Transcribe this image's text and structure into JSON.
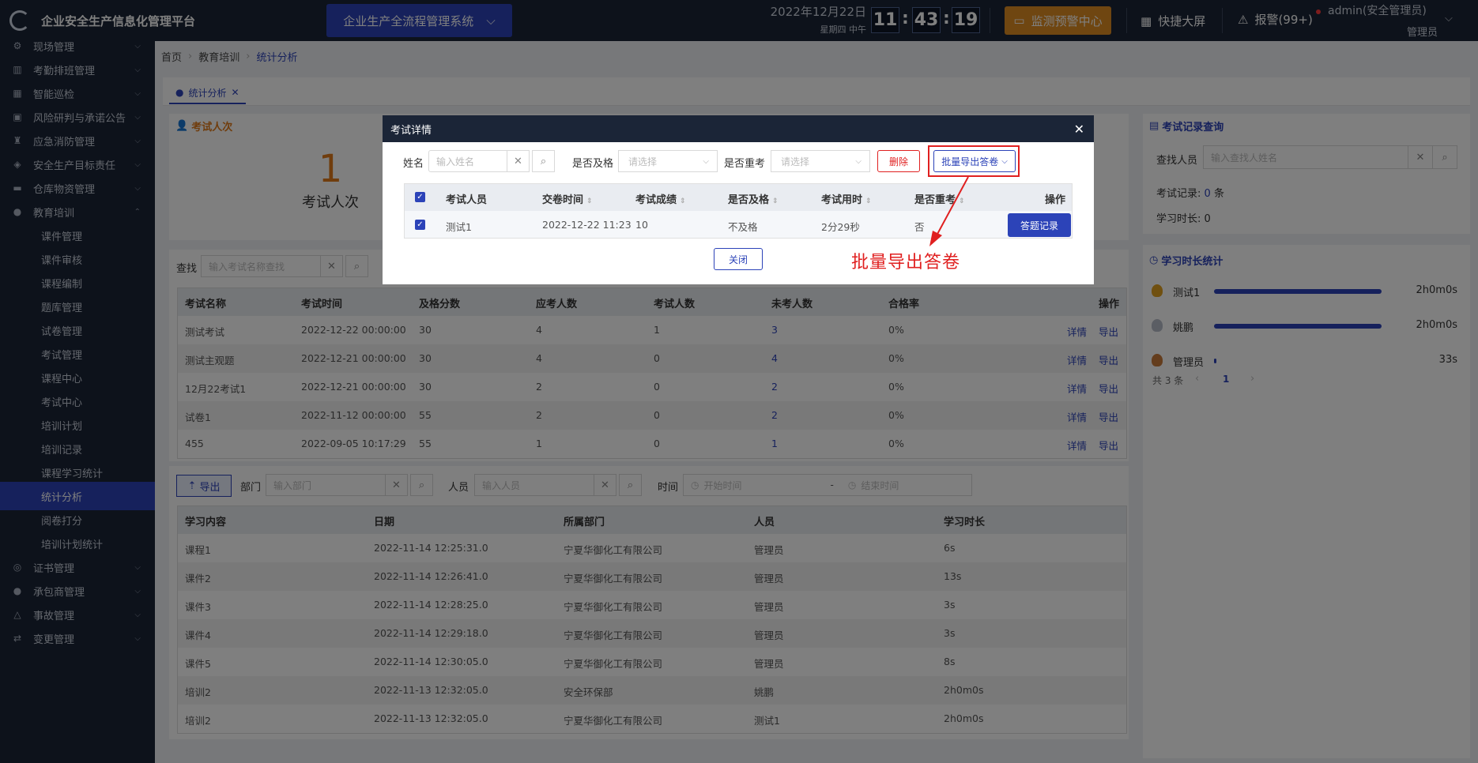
{
  "header": {
    "app_title": "企业安全生产信息化管理平台",
    "system_button": "企业生产全流程管理系统",
    "date": "2022年12月22日",
    "weekday": "星期四  中午",
    "time_h": "11",
    "time_m": "43",
    "time_s": "19",
    "monitor_button": "监测预警中心",
    "big_screen": "快捷大屏",
    "alarm": "报警(99+)",
    "user_name": "admin(安全管理员)",
    "user_role": "管理员"
  },
  "sidebar": {
    "items": [
      {
        "label": "现场管理",
        "icon": "gear-icon"
      },
      {
        "label": "考勤排班管理",
        "icon": "bar-chart-icon"
      },
      {
        "label": "智能巡检",
        "icon": "grid-icon"
      },
      {
        "label": "风险研判与承诺公告",
        "icon": "briefcase-icon"
      },
      {
        "label": "应急消防管理",
        "icon": "fire-extinguisher-icon"
      },
      {
        "label": "安全生产目标责任",
        "icon": "target-icon"
      },
      {
        "label": "仓库物资管理",
        "icon": "box-icon"
      },
      {
        "label": "教育培训",
        "icon": "user-icon"
      }
    ],
    "sub_items": [
      "课件管理",
      "课件审核",
      "课程编制",
      "题库管理",
      "试卷管理",
      "考试管理",
      "课程中心",
      "考试中心",
      "培训计划",
      "培训记录",
      "课程学习统计",
      "统计分析",
      "阅卷打分",
      "培训计划统计"
    ],
    "bottom_items": [
      {
        "label": "证书管理",
        "icon": "certificate-icon"
      },
      {
        "label": "承包商管理",
        "icon": "user-icon"
      },
      {
        "label": "事故管理",
        "icon": "warning-icon"
      },
      {
        "label": "变更管理",
        "icon": "change-icon"
      }
    ]
  },
  "breadcrumb": {
    "home": "首页",
    "parent": "教育培训",
    "current": "统计分析"
  },
  "tab": {
    "label": "统计分析"
  },
  "exam_count_panel": {
    "title": "考试人次",
    "value": "1",
    "label": "考试人次"
  },
  "exam_search": {
    "label": "查找",
    "placeholder": "输入考试名称查找"
  },
  "exam_table": {
    "headers": [
      "考试名称",
      "考试时间",
      "及格分数",
      "应考人数",
      "考试人数",
      "未考人数",
      "合格率",
      "操作"
    ],
    "rows": [
      {
        "name": "测试考试",
        "time": "2022-12-22 00:00:00",
        "pass": "30",
        "should": "4",
        "took": "1",
        "missed": "3",
        "rate": "0%"
      },
      {
        "name": "测试主观题",
        "time": "2022-12-21 00:00:00",
        "pass": "30",
        "should": "4",
        "took": "0",
        "missed": "4",
        "rate": "0%"
      },
      {
        "name": "12月22考试1",
        "time": "2022-12-21 00:00:00",
        "pass": "30",
        "should": "2",
        "took": "0",
        "missed": "2",
        "rate": "0%"
      },
      {
        "name": "试卷1",
        "time": "2022-11-12 00:00:00",
        "pass": "55",
        "should": "2",
        "took": "0",
        "missed": "2",
        "rate": "0%"
      },
      {
        "name": "455",
        "time": "2022-09-05 10:17:29",
        "pass": "55",
        "should": "1",
        "took": "0",
        "missed": "1",
        "rate": "0%"
      }
    ],
    "action_detail": "详情",
    "action_export": "导出"
  },
  "study_filter": {
    "export_button": "导出",
    "dept_label": "部门",
    "dept_placeholder": "输入部门",
    "person_label": "人员",
    "person_placeholder": "输入人员",
    "time_label": "时间",
    "start_placeholder": "开始时间",
    "dash": "-",
    "end_placeholder": "结束时间"
  },
  "study_table": {
    "headers": [
      "学习内容",
      "日期",
      "所属部门",
      "人员",
      "学习时长"
    ],
    "rows": [
      {
        "content": "课程1",
        "date": "2022-11-14 12:25:31.0",
        "dept": "宁夏华御化工有限公司",
        "person": "管理员",
        "dur": "6s"
      },
      {
        "content": "课件2",
        "date": "2022-11-14 12:26:41.0",
        "dept": "宁夏华御化工有限公司",
        "person": "管理员",
        "dur": "13s"
      },
      {
        "content": "课件3",
        "date": "2022-11-14 12:28:25.0",
        "dept": "宁夏华御化工有限公司",
        "person": "管理员",
        "dur": "3s"
      },
      {
        "content": "课件4",
        "date": "2022-11-14 12:29:18.0",
        "dept": "宁夏华御化工有限公司",
        "person": "管理员",
        "dur": "3s"
      },
      {
        "content": "课件5",
        "date": "2022-11-14 12:30:05.0",
        "dept": "宁夏华御化工有限公司",
        "person": "管理员",
        "dur": "8s"
      },
      {
        "content": "培训2",
        "date": "2022-11-13 12:32:05.0",
        "dept": "安全环保部",
        "person": "姚鹏",
        "dur": "2h0m0s"
      },
      {
        "content": "培训2",
        "date": "2022-11-13 12:32:05.0",
        "dept": "宁夏华御化工有限公司",
        "person": "测试1",
        "dur": "2h0m0s"
      }
    ]
  },
  "record_query": {
    "title": "考试记录查询",
    "find_label": "查找人员",
    "find_placeholder": "输入查找人姓名",
    "records_label": "考试记录:",
    "records_value": "0",
    "records_unit": "条",
    "study_label": "学习时长:",
    "study_value": "0"
  },
  "study_stats": {
    "title": "学习时长统计",
    "people": [
      {
        "name": "测试1",
        "dur": "2h0m0s",
        "fraction": 1.0,
        "medal_color": "#e0a020"
      },
      {
        "name": "姚鹏",
        "dur": "2h0m0s",
        "fraction": 1.0,
        "medal_color": "#b7bcc8"
      },
      {
        "name": "管理员",
        "dur": "33s",
        "fraction": 0.005,
        "medal_color": "#c97a3a"
      }
    ],
    "total": "共 3 条",
    "page": "1"
  },
  "modal": {
    "title": "考试详情",
    "name_label": "姓名",
    "name_placeholder": "输入姓名",
    "pass_label": "是否及格",
    "pass_placeholder": "请选择",
    "retake_label": "是否重考",
    "retake_placeholder": "请选择",
    "delete_button": "删除",
    "batch_export_button": "批量导出答卷",
    "table_headers": [
      "考试人员",
      "交卷时间",
      "考试成绩",
      "是否及格",
      "考试用时",
      "是否重考",
      "操作"
    ],
    "rows": [
      {
        "person": "测试1",
        "submit": "2022-12-22 11:23",
        "score": "10",
        "pass": "不及格",
        "duration": "2分29秒",
        "retake": "否",
        "action": "答题记录"
      }
    ],
    "close_button": "关闭"
  },
  "annotation": {
    "text": "批量导出答卷",
    "color": "#e02020"
  },
  "colors": {
    "brand": "#2c43b8",
    "header_bg": "#1b2537",
    "accent_orange": "#df8d23",
    "danger": "#e02020"
  }
}
